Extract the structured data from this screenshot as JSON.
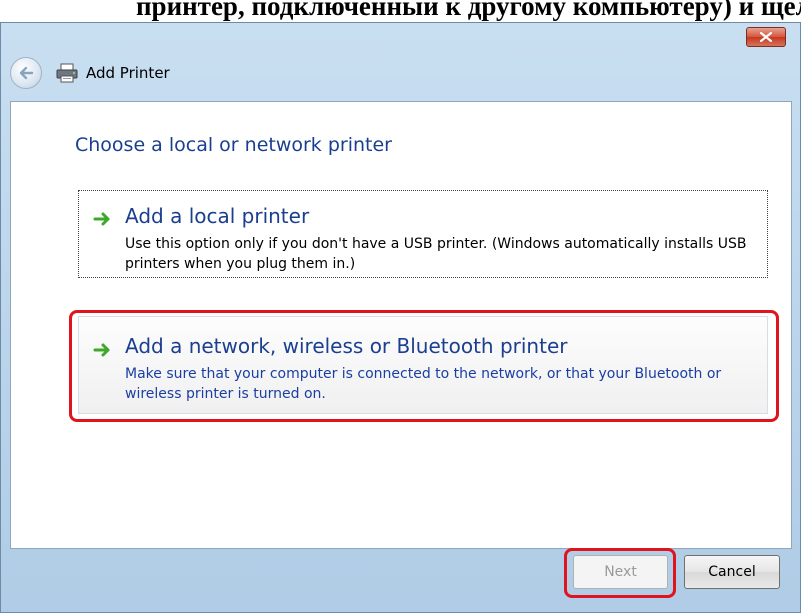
{
  "document": {
    "caption": "принтер, подключенный к другому компьютеру) и щел"
  },
  "window": {
    "title": "Add Printer",
    "title_icon": "printer-icon"
  },
  "page": {
    "heading": "Choose a local or network printer"
  },
  "options": [
    {
      "title": "Add a local printer",
      "description": "Use this option only if you don't have a USB printer. (Windows automatically installs USB printers when you plug them in.)",
      "icon": "green-arrow-icon"
    },
    {
      "title": "Add a network, wireless or Bluetooth printer",
      "description": "Make sure that your computer is connected to the network, or that your Bluetooth or wireless printer is turned on.",
      "icon": "green-arrow-icon",
      "highlighted": true
    }
  ],
  "buttons": {
    "next": "Next",
    "cancel": "Cancel"
  },
  "colors": {
    "heading_blue": "#1b3f8f",
    "highlight_red": "#e0141d",
    "arrow_green": "#3ea82a"
  }
}
